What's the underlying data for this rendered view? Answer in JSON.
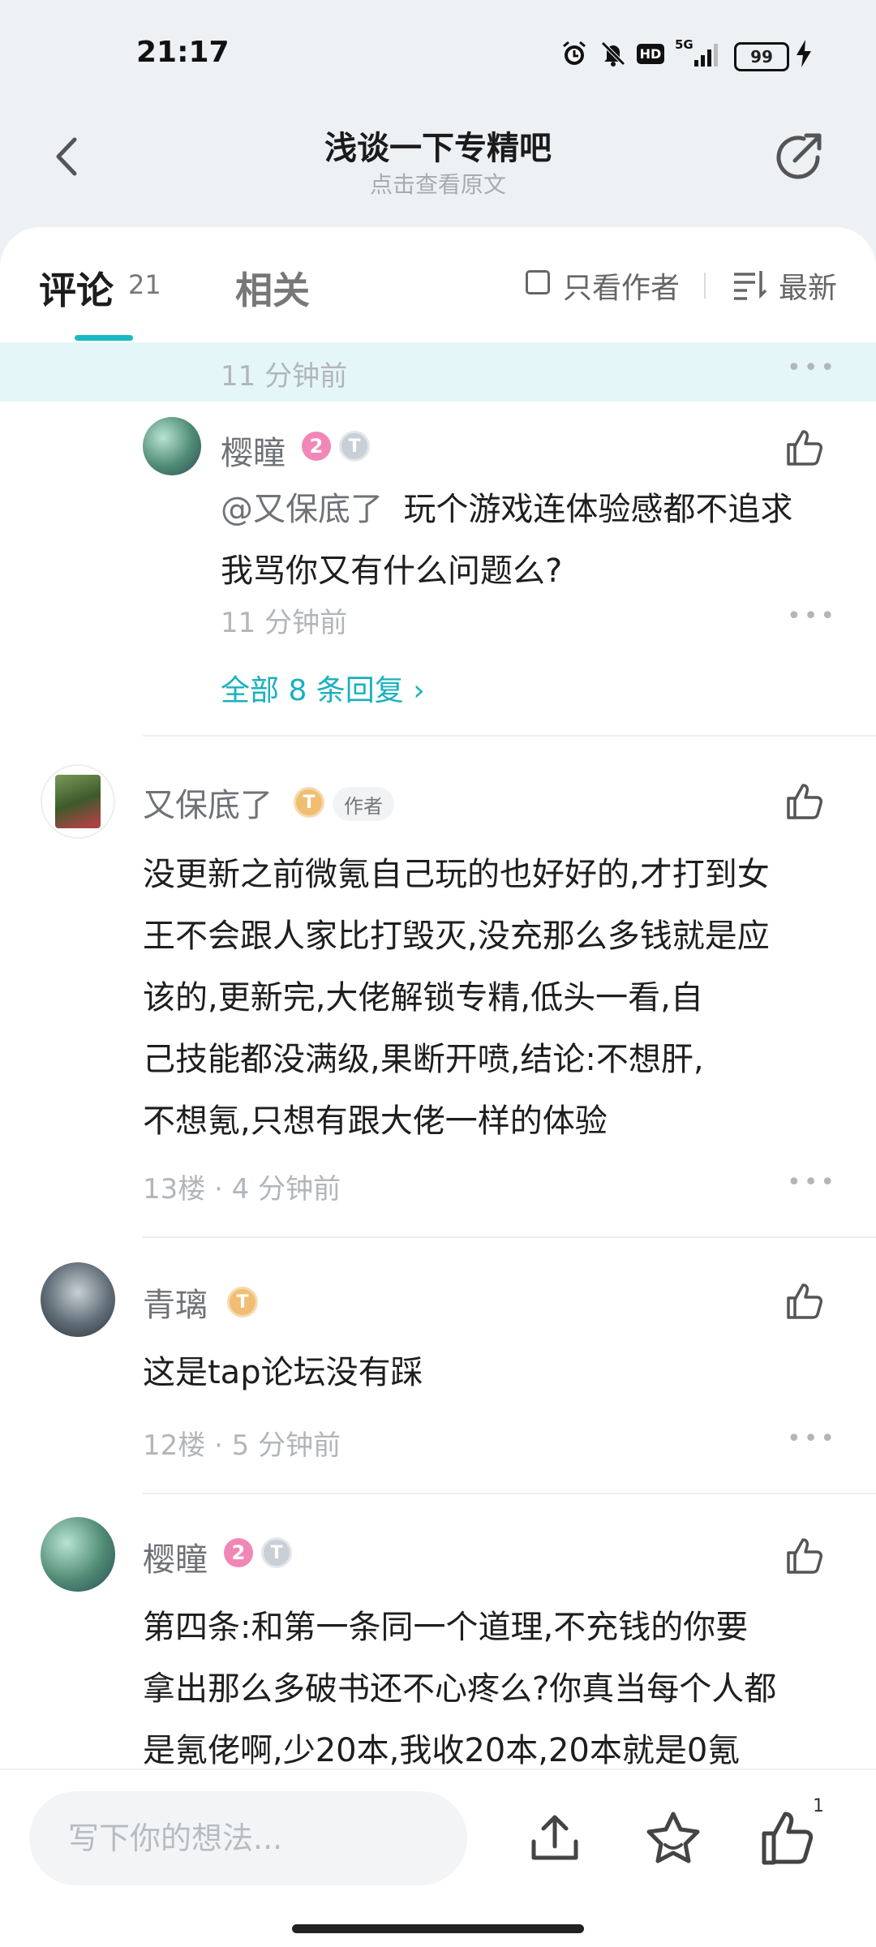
{
  "status_bar": {
    "time": "21:17",
    "network": "5G",
    "hd": "HD",
    "battery": "99"
  },
  "header": {
    "title": "浅谈一下专精吧",
    "subtitle": "点击查看原文"
  },
  "tabs": {
    "comments_label": "评论",
    "comments_count": "21",
    "related_label": "相关"
  },
  "filters": {
    "author_only": "只看作者",
    "sort": "最新"
  },
  "highlight": {
    "time": "11 分钟前"
  },
  "reply": {
    "username": "樱瞳",
    "level": "2",
    "mention": "@又保底了",
    "text_line1": "玩个游戏连体验感都不追求",
    "text_line2": "我骂你又有什么问题么?",
    "time": "11 分钟前",
    "all_replies": "全部 8 条回复"
  },
  "comments": [
    {
      "username": "又保底了",
      "author_tag": "作者",
      "lines": [
        "没更新之前微氪自己玩的也好好的,才打到女",
        "王不会跟人家比打毁灭,没充那么多钱就是应",
        "该的,更新完,大佬解锁专精,低头一看,自",
        "己技能都没满级,果断开喷,结论:不想肝,",
        "不想氪,只想有跟大佬一样的体验"
      ],
      "meta": "13楼 · 4 分钟前"
    },
    {
      "username": "青璃",
      "lines": [
        "这是tap论坛没有踩"
      ],
      "meta": "12楼 · 5 分钟前"
    },
    {
      "username": "樱瞳",
      "level": "2",
      "lines": [
        "第四条:和第一条同一个道理,不充钱的你要",
        "拿出那么多破书还不心疼么?你真当每个人都",
        "是氪佬啊,少20本,我收20本,20本就是0氪"
      ]
    }
  ],
  "bottom_bar": {
    "input_placeholder": "写下你的想法...",
    "like_count": "1"
  },
  "icons": [
    "alarm-icon",
    "mute-icon",
    "signal-icon",
    "battery-icon",
    "charging-icon",
    "back-icon",
    "share-icon",
    "sort-icon",
    "like-icon",
    "more-icon",
    "upload-icon",
    "star-icon",
    "chevron-right-icon"
  ],
  "colors": {
    "accent": "#19b9c3",
    "highlight_bg": "#e4f6f8",
    "level_badge": "#f187b6"
  }
}
